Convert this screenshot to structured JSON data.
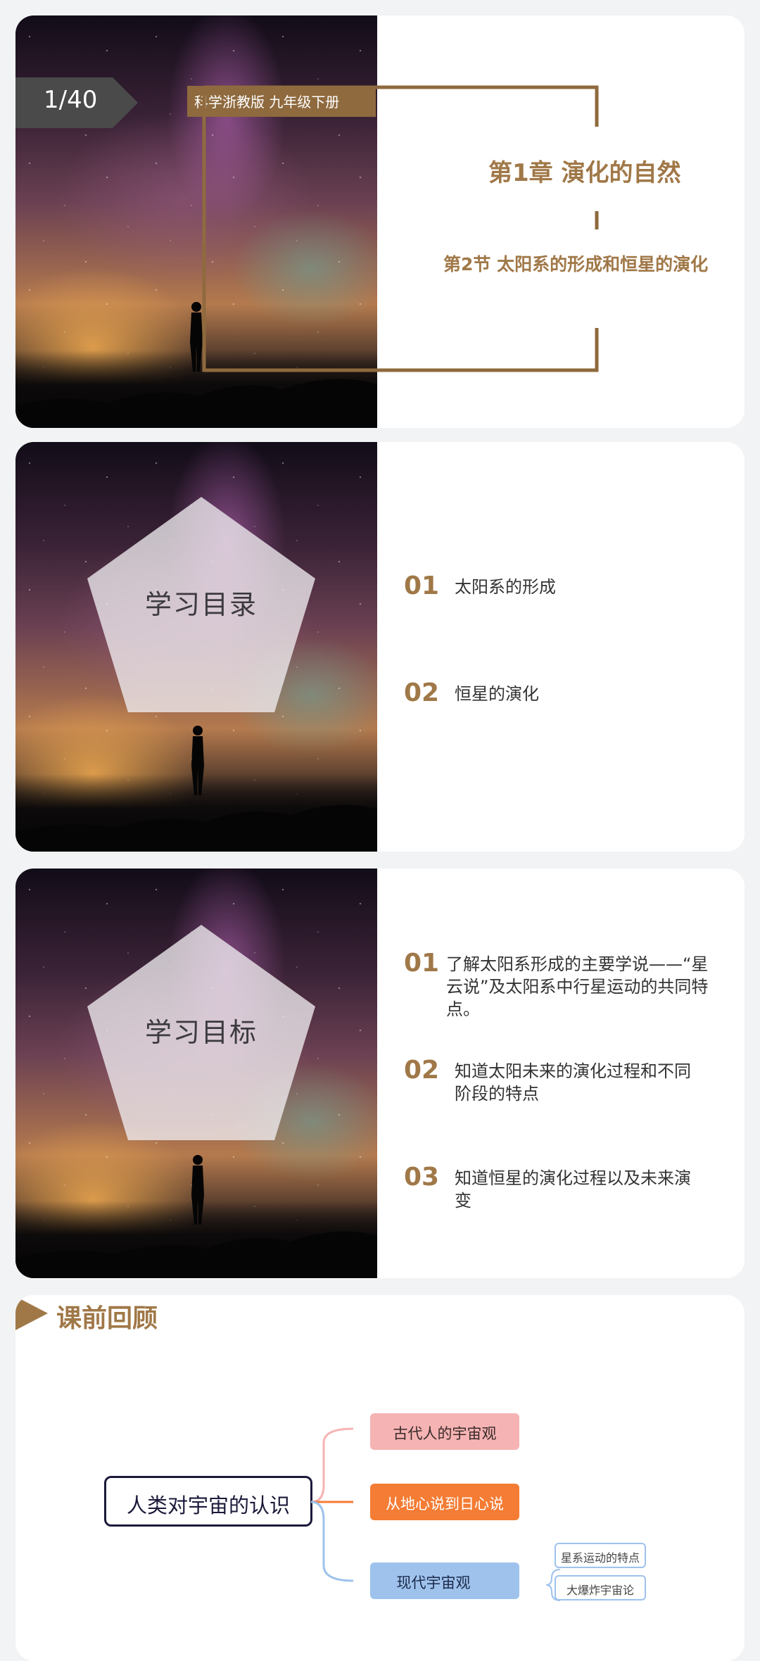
{
  "slide1": {
    "page_counter": "1/40",
    "edition": "科学浙教版  九年级下册",
    "chapter": "第1章  演化的自然",
    "section": "第2节  太阳系的形成和恒星的演化"
  },
  "slide2": {
    "heading": "学习目录",
    "items": [
      {
        "num": "01",
        "text": "太阳系的形成"
      },
      {
        "num": "02",
        "text": "恒星的演化"
      }
    ]
  },
  "slide3": {
    "heading": "学习目标",
    "items": [
      {
        "num": "01",
        "text": "了解太阳系形成的主要学说——“星云说”及太阳系中行星运动的共同特点。"
      },
      {
        "num": "02",
        "text": "知道太阳未来的演化过程和不同阶段的特点"
      },
      {
        "num": "03",
        "text": "知道恒星的演化过程以及未来演变"
      }
    ]
  },
  "slide4": {
    "heading": "课前回顾",
    "mindmap": {
      "root": "人类对宇宙的认识",
      "branches": [
        {
          "label": "古代人的宇宙观",
          "color": "#f6b3b3"
        },
        {
          "label": "从地心说到日心说",
          "color": "#f47c34"
        },
        {
          "label": "现代宇宙观",
          "color": "#9ec2ec"
        }
      ],
      "leaves": [
        "星系运动的特点",
        "大爆炸宇宙论"
      ]
    }
  },
  "colors": {
    "accent": "#a07848",
    "bracket": "#8f6a3e",
    "page_bg": "#f2f3f5"
  }
}
